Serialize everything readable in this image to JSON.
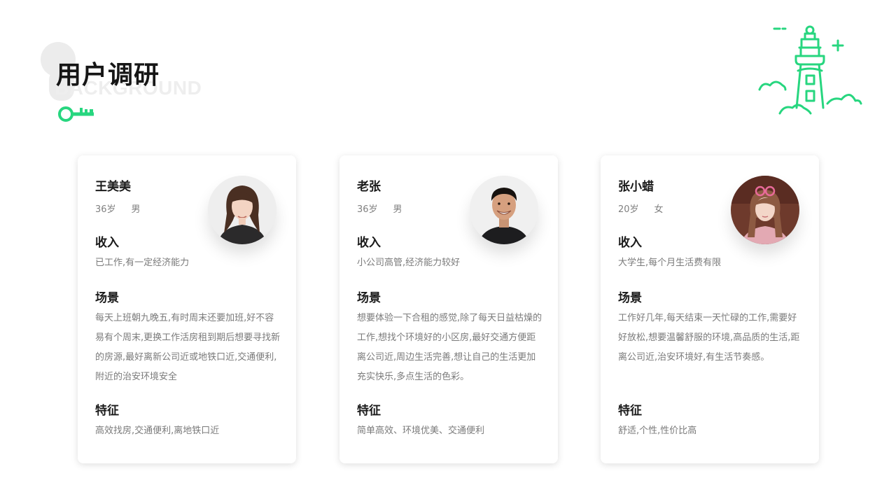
{
  "page": {
    "title": "用户调研",
    "bg_word": "BACKGROUND",
    "accent_color": "#27d67f"
  },
  "decor": {
    "key_icon": "key-icon",
    "lighthouse_icon": "lighthouse-icon"
  },
  "cards": [
    {
      "name": "王美美",
      "age": "36岁",
      "gender": "男",
      "avatar": "avatar-woman-long-hair",
      "income_title": "收入",
      "income_text": "已工作,有一定经济能力",
      "scene_title": "场景",
      "scene_text": "每天上班朝九晚五,有时周末还要加班,好不容易有个周末,更换工作活房租到期后想要寻找新的房源,最好离新公司近或地铁口近,交通便利,附近的治安环境安全",
      "feature_title": "特征",
      "feature_text": "高效找房,交通便利,离地铁口近"
    },
    {
      "name": "老张",
      "age": "36岁",
      "gender": "男",
      "avatar": "avatar-man-smiling",
      "income_title": "收入",
      "income_text": "小公司高管,经济能力较好",
      "scene_title": "场景",
      "scene_text": "想要体验一下合租的感觉,除了每天日益枯燥的工作,想找个环境好的小区房,最好交通方便距离公司近,周边生活完善,想让自己的生活更加充实快乐,多点生活的色彩。",
      "feature_title": "特征",
      "feature_text": "简单高效、环境优美、交通便利"
    },
    {
      "name": "张小蜡",
      "age": "20岁",
      "gender": "女",
      "avatar": "avatar-girl-braids",
      "income_title": "收入",
      "income_text": "大学生,每个月生活费有限",
      "scene_title": "场景",
      "scene_text": "工作好几年,每天结束一天忙碌的工作,需要好好放松,想要温馨舒服的环境,高品质的生活,距离公司近,治安环境好,有生活节奏感。",
      "feature_title": "特征",
      "feature_text": "舒适,个性,性价比高"
    }
  ]
}
